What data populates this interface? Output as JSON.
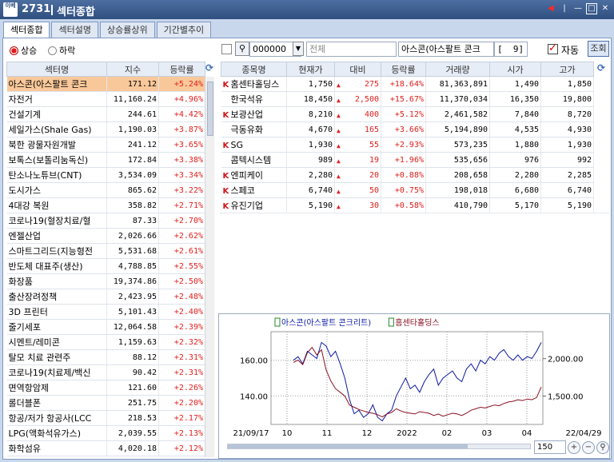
{
  "window": {
    "logo": "이베",
    "code": "2731",
    "title": "섹터종합"
  },
  "tabs": [
    "섹터종합",
    "섹터설명",
    "상승률상위",
    "기간별추이"
  ],
  "filters": {
    "up_label": "상승",
    "down_label": "하락"
  },
  "stock_search": {
    "code": "000000",
    "placeholder": "전체",
    "sector_field": "아스콘(아스팔트 콘크",
    "count": "[  9]",
    "auto_label": "자동",
    "query_label": "조회"
  },
  "colors": {
    "up": "#e0201c",
    "selected_row": "#f9c89a",
    "series1": "#0b1aa0",
    "series2": "#8a1020"
  },
  "left_table": {
    "headers": [
      "섹터명",
      "지수",
      "등락률"
    ],
    "rows": [
      {
        "name": "아스콘(아스팔트 콘크",
        "index": "171.12",
        "rate": "+5.24%"
      },
      {
        "name": "자전거",
        "index": "11,160.24",
        "rate": "+4.96%"
      },
      {
        "name": "건설기계",
        "index": "244.61",
        "rate": "+4.42%"
      },
      {
        "name": "세일가스(Shale Gas)",
        "index": "1,190.03",
        "rate": "+3.87%"
      },
      {
        "name": "북한 광물자원개발",
        "index": "241.12",
        "rate": "+3.65%"
      },
      {
        "name": "보톡스(보톨리눔독신)",
        "index": "172.84",
        "rate": "+3.38%"
      },
      {
        "name": "탄소나노튜브(CNT)",
        "index": "3,534.09",
        "rate": "+3.34%"
      },
      {
        "name": "도시가스",
        "index": "865.62",
        "rate": "+3.22%"
      },
      {
        "name": "4대강 복원",
        "index": "358.82",
        "rate": "+2.71%"
      },
      {
        "name": "코로나19(혈장치료/혈",
        "index": "87.33",
        "rate": "+2.70%"
      },
      {
        "name": "엔젤산업",
        "index": "2,026.66",
        "rate": "+2.62%"
      },
      {
        "name": "스마트그리드(지능형전",
        "index": "5,531.68",
        "rate": "+2.61%"
      },
      {
        "name": "반도체 대표주(생산)",
        "index": "4,788.85",
        "rate": "+2.55%"
      },
      {
        "name": "화장품",
        "index": "19,374.86",
        "rate": "+2.50%"
      },
      {
        "name": "출산장려정책",
        "index": "2,423.95",
        "rate": "+2.48%"
      },
      {
        "name": "3D 프린터",
        "index": "5,101.43",
        "rate": "+2.40%"
      },
      {
        "name": "줄기세포",
        "index": "12,064.58",
        "rate": "+2.39%"
      },
      {
        "name": "시멘트/레미콘",
        "index": "1,159.63",
        "rate": "+2.32%"
      },
      {
        "name": "탈모 치료 관련주",
        "index": "88.12",
        "rate": "+2.31%"
      },
      {
        "name": "코로나19(치료제/백신",
        "index": "90.42",
        "rate": "+2.31%"
      },
      {
        "name": "면역항암제",
        "index": "121.60",
        "rate": "+2.26%"
      },
      {
        "name": "롤더블폰",
        "index": "251.75",
        "rate": "+2.20%"
      },
      {
        "name": "항공/저가 항공사(LCC",
        "index": "218.53",
        "rate": "+2.17%"
      },
      {
        "name": "LPG(액화석유가스)",
        "index": "2,039.55",
        "rate": "+2.13%"
      },
      {
        "name": "화학섬유",
        "index": "4,020.18",
        "rate": "+2.12%"
      }
    ]
  },
  "right_table": {
    "headers": [
      "종목명",
      "현재가",
      "대비",
      "등락률",
      "거래량",
      "시가",
      "고가"
    ],
    "rows": [
      {
        "k": "K",
        "name": "홈센타홀딩스",
        "price": "1,750",
        "change": "275",
        "rate": "+18.64%",
        "volume": "81,363,891",
        "open": "1,490",
        "high": "1,850"
      },
      {
        "k": "",
        "name": "한국석유",
        "price": "18,450",
        "change": "2,500",
        "rate": "+15.67%",
        "volume": "11,370,034",
        "open": "16,350",
        "high": "19,800"
      },
      {
        "k": "K",
        "name": "보광산업",
        "price": "8,210",
        "change": "400",
        "rate": "+5.12%",
        "volume": "2,461,582",
        "open": "7,840",
        "high": "8,720"
      },
      {
        "k": "",
        "name": "극동유화",
        "price": "4,670",
        "change": "165",
        "rate": "+3.66%",
        "volume": "5,194,890",
        "open": "4,535",
        "high": "4,930"
      },
      {
        "k": "K",
        "name": "SG",
        "price": "1,930",
        "change": "55",
        "rate": "+2.93%",
        "volume": "573,235",
        "open": "1,880",
        "high": "1,930"
      },
      {
        "k": "",
        "name": "콤텍시스템",
        "price": "989",
        "change": "19",
        "rate": "+1.96%",
        "volume": "535,656",
        "open": "976",
        "high": "992"
      },
      {
        "k": "K",
        "name": "엔피케이",
        "price": "2,280",
        "change": "20",
        "rate": "+0.88%",
        "volume": "208,658",
        "open": "2,280",
        "high": "2,285"
      },
      {
        "k": "K",
        "name": "스페코",
        "price": "6,740",
        "change": "50",
        "rate": "+0.75%",
        "volume": "198,018",
        "open": "6,680",
        "high": "6,740"
      },
      {
        "k": "K",
        "name": "유진기업",
        "price": "5,190",
        "change": "30",
        "rate": "+0.58%",
        "volume": "410,790",
        "open": "5,170",
        "high": "5,190"
      }
    ]
  },
  "chart_data": {
    "type": "line",
    "legend": [
      "아스콘(아스팔트 콘크리트)",
      "홈센타홀딩스"
    ],
    "x_ticks": [
      "21/09/17",
      "10",
      "11",
      "12",
      "2022",
      "02",
      "03",
      "04",
      "22/04/29"
    ],
    "y_left_ticks": [
      "160.00",
      "140.00"
    ],
    "y_right_ticks": [
      "2,000.00",
      "1,500.00"
    ],
    "y_left_range": [
      124,
      176
    ],
    "y_right_range": [
      1120,
      2360
    ],
    "series": [
      {
        "name": "아스콘(아스팔트 콘크리트)",
        "axis": "left",
        "values": [
          160,
          162,
          158,
          165,
          163,
          161,
          170,
          168,
          162,
          165,
          158,
          150,
          138,
          130,
          132,
          128,
          130,
          135,
          128,
          126,
          130,
          132,
          140,
          145,
          150,
          144,
          146,
          142,
          148,
          152,
          155,
          146,
          150,
          152,
          154,
          150,
          148,
          155,
          158,
          154,
          160,
          158,
          162,
          160,
          164,
          166,
          162,
          160,
          163,
          160,
          162,
          161,
          165,
          170
        ]
      },
      {
        "name": "홈센타홀딩스",
        "axis": "right",
        "values": [
          1950,
          1980,
          1920,
          2080,
          2150,
          2050,
          2120,
          1850,
          1700,
          1600,
          1550,
          1500,
          1380,
          1350,
          1320,
          1300,
          1280,
          1270,
          1250,
          1220,
          1260,
          1280,
          1330,
          1300,
          1280,
          1270,
          1260,
          1290,
          1280,
          1270,
          1240,
          1260,
          1230,
          1250,
          1270,
          1260,
          1240,
          1270,
          1310,
          1330,
          1350,
          1340,
          1360,
          1380,
          1370,
          1400,
          1420,
          1430,
          1450,
          1440,
          1460,
          1450,
          1480,
          1620
        ]
      }
    ]
  },
  "chart_controls": {
    "zoom_value": "150"
  }
}
